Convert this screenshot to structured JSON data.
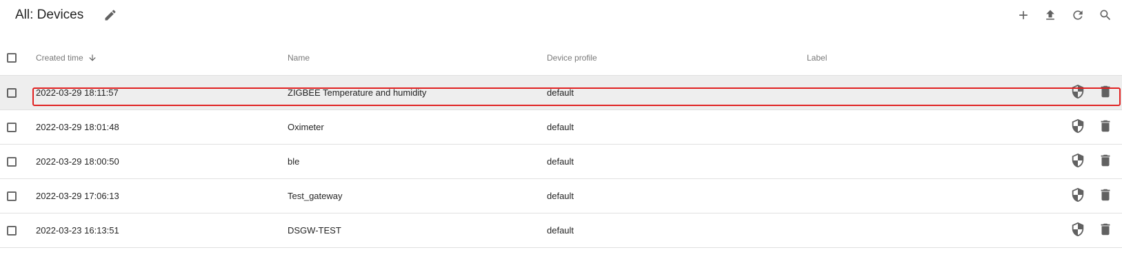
{
  "header": {
    "title": "All: Devices"
  },
  "table": {
    "columns": {
      "created_time": "Created time",
      "name": "Name",
      "device_profile": "Device profile",
      "label": "Label"
    },
    "rows": [
      {
        "created_time": "2022-03-29 18:11:57",
        "name": "ZIGBEE Temperature and humidity",
        "device_profile": "default",
        "label": ""
      },
      {
        "created_time": "2022-03-29 18:01:48",
        "name": "Oximeter",
        "device_profile": "default",
        "label": ""
      },
      {
        "created_time": "2022-03-29 18:00:50",
        "name": "ble",
        "device_profile": "default",
        "label": ""
      },
      {
        "created_time": "2022-03-29 17:06:13",
        "name": "Test_gateway",
        "device_profile": "default",
        "label": ""
      },
      {
        "created_time": "2022-03-23 16:13:51",
        "name": "DSGW-TEST",
        "device_profile": "default",
        "label": ""
      }
    ]
  },
  "icons": {
    "edit": "pencil-icon",
    "add": "plus-icon",
    "upload": "upload-icon",
    "refresh": "refresh-icon",
    "search": "search-icon",
    "sort": "arrow-down-icon",
    "credentials": "shield-icon",
    "delete": "trash-icon"
  },
  "colors": {
    "icon": "#616161",
    "highlight_border": "#e02020",
    "row_highlight": "#eeeeee"
  }
}
